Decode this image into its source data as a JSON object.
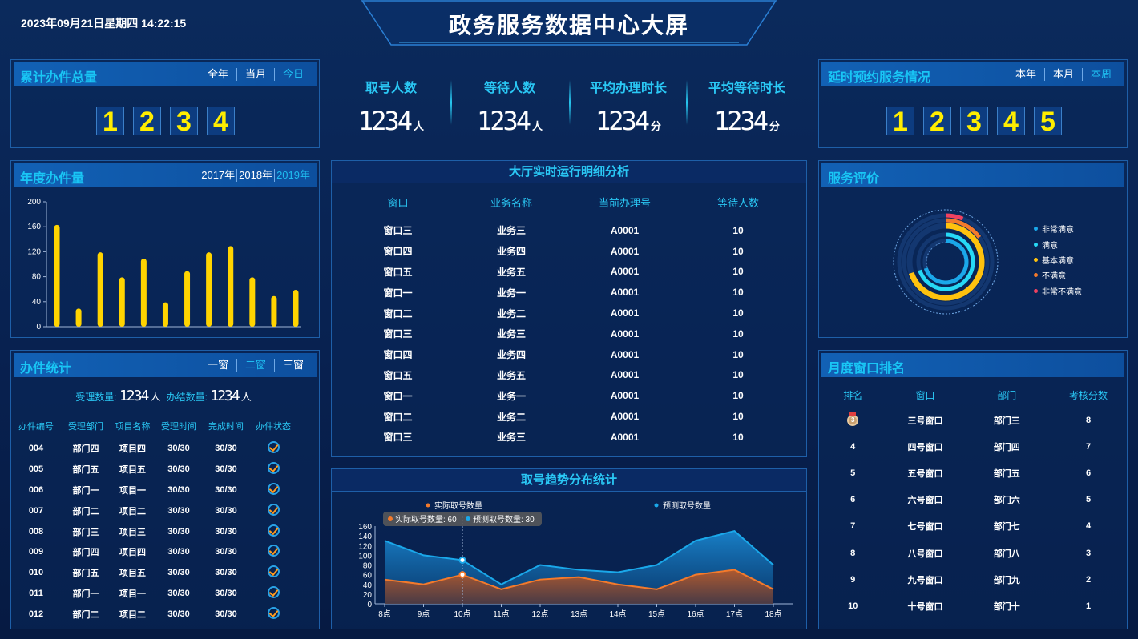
{
  "header": {
    "datetime": "2023年09月21日星期四 14:22:15",
    "title": "政务服务数据中心大屏"
  },
  "total_cases": {
    "title": "累计办件总量",
    "tabs": [
      "全年",
      "当月",
      "今日"
    ],
    "digits": [
      "1",
      "2",
      "3",
      "4"
    ]
  },
  "annual_cases": {
    "title": "年度办件量",
    "tabs": [
      "2017年",
      "2018年",
      "2019年"
    ]
  },
  "case_stats": {
    "title": "办件统计",
    "tabs": [
      "一窗",
      "二窗",
      "三窗"
    ],
    "accepted_label": "受理数量:",
    "accepted_value": "1234",
    "accepted_unit": "人",
    "completed_label": "办结数量:",
    "completed_value": "1234",
    "completed_unit": "人",
    "columns": [
      "办件编号",
      "受理部门",
      "项目名称",
      "受理时间",
      "完成时间",
      "办件状态"
    ],
    "rows": [
      [
        "004",
        "部门四",
        "项目四",
        "30/30",
        "30/30"
      ],
      [
        "005",
        "部门五",
        "项目五",
        "30/30",
        "30/30"
      ],
      [
        "006",
        "部门一",
        "项目一",
        "30/30",
        "30/30"
      ],
      [
        "007",
        "部门二",
        "项目二",
        "30/30",
        "30/30"
      ],
      [
        "008",
        "部门三",
        "项目三",
        "30/30",
        "30/30"
      ],
      [
        "009",
        "部门四",
        "项目四",
        "30/30",
        "30/30"
      ],
      [
        "010",
        "部门五",
        "项目五",
        "30/30",
        "30/30"
      ],
      [
        "011",
        "部门一",
        "项目一",
        "30/30",
        "30/30"
      ],
      [
        "012",
        "部门二",
        "项目二",
        "30/30",
        "30/30"
      ]
    ],
    "status_icon": "check-circle-icon"
  },
  "stats": [
    {
      "label": "取号人数",
      "value": "1234",
      "unit": "人"
    },
    {
      "label": "等待人数",
      "value": "1234",
      "unit": "人"
    },
    {
      "label": "平均办理时长",
      "value": "1234",
      "unit": "分"
    },
    {
      "label": "平均等待时长",
      "value": "1234",
      "unit": "分"
    }
  ],
  "hall": {
    "title": "大厅实时运行明细分析",
    "columns": [
      "窗口",
      "业务名称",
      "当前办理号",
      "等待人数"
    ],
    "rows": [
      [
        "窗口三",
        "业务三",
        "A0001",
        "10"
      ],
      [
        "窗口四",
        "业务四",
        "A0001",
        "10"
      ],
      [
        "窗口五",
        "业务五",
        "A0001",
        "10"
      ],
      [
        "窗口一",
        "业务一",
        "A0001",
        "10"
      ],
      [
        "窗口二",
        "业务二",
        "A0001",
        "10"
      ],
      [
        "窗口三",
        "业务三",
        "A0001",
        "10"
      ],
      [
        "窗口四",
        "业务四",
        "A0001",
        "10"
      ],
      [
        "窗口五",
        "业务五",
        "A0001",
        "10"
      ],
      [
        "窗口一",
        "业务一",
        "A0001",
        "10"
      ],
      [
        "窗口二",
        "业务二",
        "A0001",
        "10"
      ],
      [
        "窗口三",
        "业务三",
        "A0001",
        "10"
      ]
    ]
  },
  "trend": {
    "title": "取号趋势分布统计",
    "tooltip": {
      "actual": "实际取号数量: 60",
      "predicted": "预测取号数量: 30"
    }
  },
  "delay": {
    "title": "延时预约服务情况",
    "tabs": [
      "本年",
      "本月",
      "本周"
    ],
    "digits": [
      "1",
      "2",
      "3",
      "4",
      "5"
    ]
  },
  "rating": {
    "title": "服务评价",
    "legend": [
      {
        "label": "非常满意",
        "color": "#1aa8ea"
      },
      {
        "label": "满意",
        "color": "#27d8f5"
      },
      {
        "label": "基本满意",
        "color": "#ffc20e"
      },
      {
        "label": "不满意",
        "color": "#f47a2b"
      },
      {
        "label": "非常不满意",
        "color": "#ef4160"
      }
    ]
  },
  "ranking": {
    "title": "月度窗口排名",
    "columns": [
      "排名",
      "窗口",
      "部门",
      "考核分数"
    ],
    "rows": [
      [
        "3",
        "三号窗口",
        "部门三",
        "8"
      ],
      [
        "4",
        "四号窗口",
        "部门四",
        "7"
      ],
      [
        "5",
        "五号窗口",
        "部门五",
        "6"
      ],
      [
        "6",
        "六号窗口",
        "部门六",
        "5"
      ],
      [
        "7",
        "七号窗口",
        "部门七",
        "4"
      ],
      [
        "8",
        "八号窗口",
        "部门八",
        "3"
      ],
      [
        "9",
        "九号窗口",
        "部门九",
        "2"
      ],
      [
        "10",
        "十号窗口",
        "部门十",
        "1"
      ]
    ]
  },
  "chart_data": [
    {
      "type": "bar",
      "values": [
        163,
        29,
        119,
        79,
        109,
        39,
        89,
        119,
        129,
        79,
        49,
        59
      ],
      "ylim": [
        0,
        200
      ],
      "yticks": [
        "0",
        "40",
        "80",
        "120",
        "160",
        "200"
      ],
      "color": "#ffd400"
    },
    {
      "type": "area",
      "categories": [
        "8点",
        "9点",
        "10点",
        "11点",
        "12点",
        "13点",
        "14点",
        "15点",
        "16点",
        "17点",
        "18点"
      ],
      "series": [
        {
          "name": "实际取号数量",
          "values": [
            50,
            40,
            60,
            30,
            50,
            55,
            40,
            30,
            60,
            70,
            30
          ],
          "color": "#f47a2b"
        },
        {
          "name": "预测取号数量",
          "values": [
            130,
            100,
            90,
            40,
            80,
            70,
            65,
            80,
            130,
            150,
            80
          ],
          "color": "#1aa8ea"
        }
      ],
      "ylim": [
        0,
        160
      ],
      "yticks": [
        "0",
        "20",
        "40",
        "60",
        "80",
        "100",
        "120",
        "140",
        "160"
      ],
      "legend": "top"
    },
    {
      "type": "pie",
      "labels": [
        "非常满意",
        "满意",
        "基本满意",
        "不满意",
        "非常不满意"
      ],
      "fractions": [
        0.7,
        0.7,
        0.7,
        0.15,
        0.06
      ]
    }
  ]
}
